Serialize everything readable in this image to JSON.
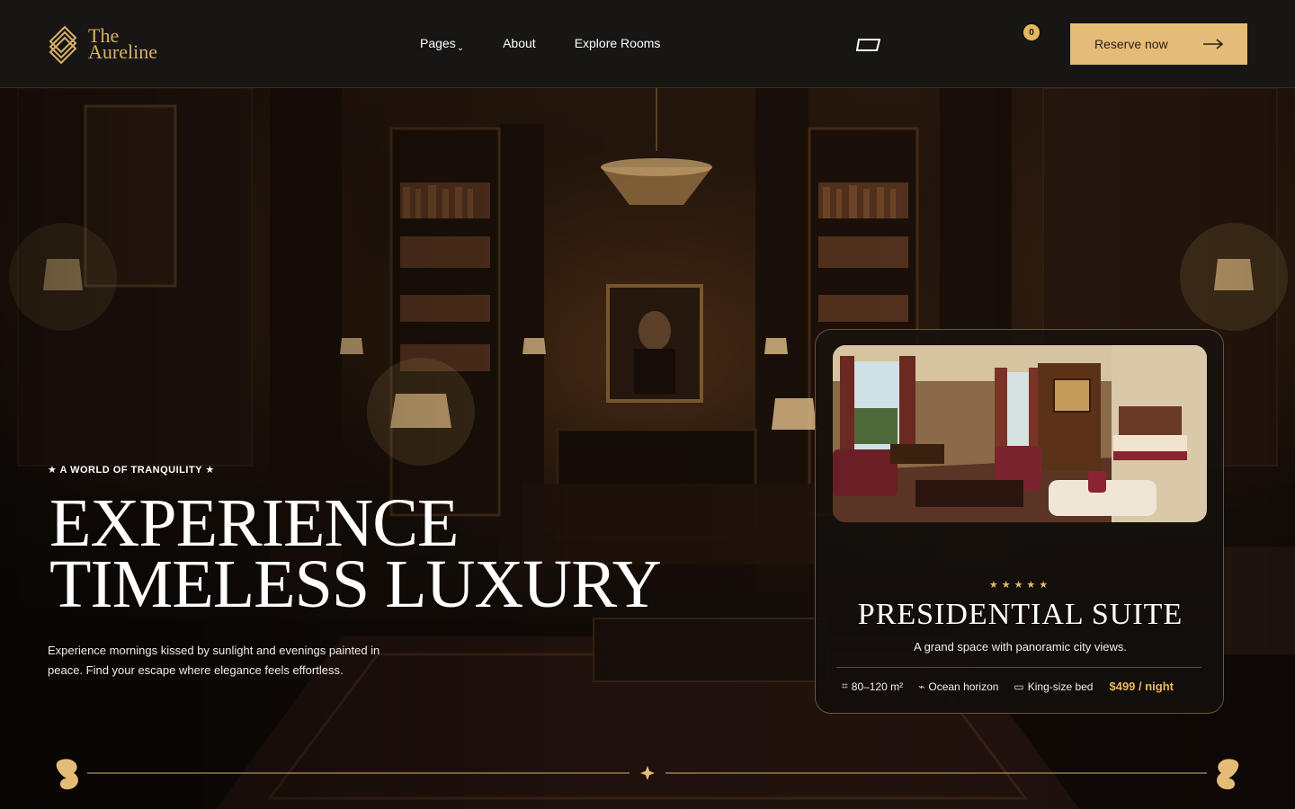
{
  "brand": {
    "line1": "The",
    "line2": "Aureline"
  },
  "nav": {
    "items": [
      {
        "label": "Pages",
        "chevron": "⌄"
      },
      {
        "label": "About"
      },
      {
        "label": "Explore Rooms"
      }
    ]
  },
  "cart": {
    "count": "0",
    "icon": "cart-icon"
  },
  "reserve": {
    "label": "Reserve now",
    "icon": "arrow-right-icon"
  },
  "hero": {
    "eyebrow": "★ A WORLD OF TRANQUILITY ★",
    "headline_line1": "EXPERIENCE",
    "headline_line2": "TIMELESS LUXURY",
    "lead": "Experience mornings kissed by sunlight and evenings painted in peace. Find your escape where elegance feels effortless."
  },
  "suite": {
    "stars": "★★★★★",
    "title": "PRESIDENTIAL SUITE",
    "subtitle": "A grand space with panoramic city views.",
    "features": [
      {
        "icon": "⌗",
        "label": "80–120 m²"
      },
      {
        "icon": "⌁",
        "label": "Ocean horizon"
      },
      {
        "icon": "▭",
        "label": "King-size bed"
      }
    ],
    "price": "$499 / night"
  },
  "colors": {
    "gold": "#e4bc78",
    "accent": "#e8b760",
    "header_bg": "#171615"
  }
}
